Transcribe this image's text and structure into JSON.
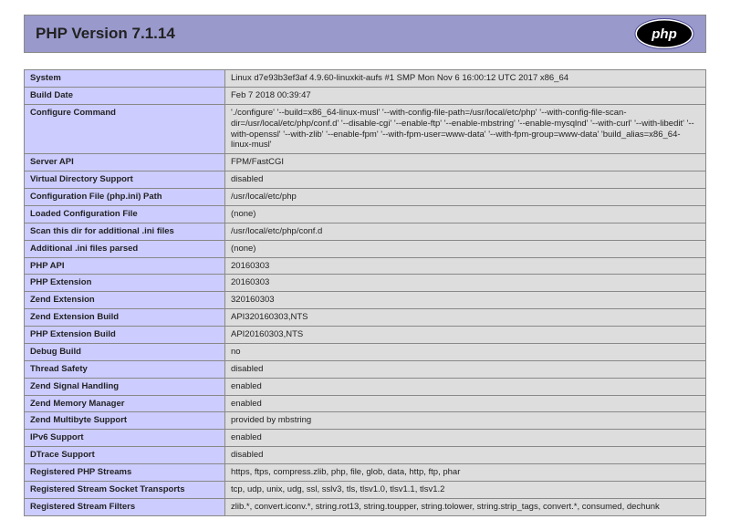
{
  "header": {
    "title": "PHP Version 7.1.14",
    "logo_text": "php"
  },
  "rows": [
    {
      "label": "System",
      "value": "Linux d7e93b3ef3af 4.9.60-linuxkit-aufs #1 SMP Mon Nov 6 16:00:12 UTC 2017 x86_64"
    },
    {
      "label": "Build Date",
      "value": "Feb 7 2018 00:39:47"
    },
    {
      "label": "Configure Command",
      "value": "'./configure' '--build=x86_64-linux-musl' '--with-config-file-path=/usr/local/etc/php' '--with-config-file-scan-dir=/usr/local/etc/php/conf.d' '--disable-cgi' '--enable-ftp' '--enable-mbstring' '--enable-mysqlnd' '--with-curl' '--with-libedit' '--with-openssl' '--with-zlib' '--enable-fpm' '--with-fpm-user=www-data' '--with-fpm-group=www-data' 'build_alias=x86_64-linux-musl'"
    },
    {
      "label": "Server API",
      "value": "FPM/FastCGI"
    },
    {
      "label": "Virtual Directory Support",
      "value": "disabled"
    },
    {
      "label": "Configuration File (php.ini) Path",
      "value": "/usr/local/etc/php"
    },
    {
      "label": "Loaded Configuration File",
      "value": "(none)"
    },
    {
      "label": "Scan this dir for additional .ini files",
      "value": "/usr/local/etc/php/conf.d"
    },
    {
      "label": "Additional .ini files parsed",
      "value": "(none)"
    },
    {
      "label": "PHP API",
      "value": "20160303"
    },
    {
      "label": "PHP Extension",
      "value": "20160303"
    },
    {
      "label": "Zend Extension",
      "value": "320160303"
    },
    {
      "label": "Zend Extension Build",
      "value": "API320160303,NTS"
    },
    {
      "label": "PHP Extension Build",
      "value": "API20160303,NTS"
    },
    {
      "label": "Debug Build",
      "value": "no"
    },
    {
      "label": "Thread Safety",
      "value": "disabled"
    },
    {
      "label": "Zend Signal Handling",
      "value": "enabled"
    },
    {
      "label": "Zend Memory Manager",
      "value": "enabled"
    },
    {
      "label": "Zend Multibyte Support",
      "value": "provided by mbstring"
    },
    {
      "label": "IPv6 Support",
      "value": "enabled"
    },
    {
      "label": "DTrace Support",
      "value": "disabled"
    },
    {
      "label": "Registered PHP Streams",
      "value": "https, ftps, compress.zlib, php, file, glob, data, http, ftp, phar"
    },
    {
      "label": "Registered Stream Socket Transports",
      "value": "tcp, udp, unix, udg, ssl, sslv3, tls, tlsv1.0, tlsv1.1, tlsv1.2"
    },
    {
      "label": "Registered Stream Filters",
      "value": "zlib.*, convert.iconv.*, string.rot13, string.toupper, string.tolower, string.strip_tags, convert.*, consumed, dechunk"
    }
  ]
}
